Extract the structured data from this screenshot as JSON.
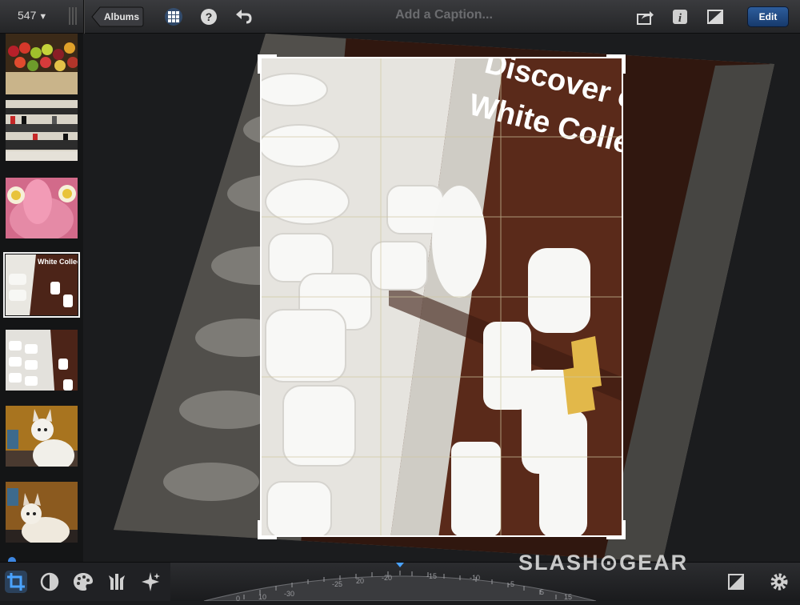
{
  "topbar": {
    "photo_count": "547",
    "albums_label": "Albums",
    "caption_placeholder": "Add a Caption...",
    "edit_label": "Edit"
  },
  "photo": {
    "sign_line1": "Discover our",
    "sign_line2": "White Collection"
  },
  "filmstrip": {
    "thumbnails": [
      {
        "subject": "produce display"
      },
      {
        "subject": "store shelves"
      },
      {
        "subject": "pink face"
      },
      {
        "subject": "white collection",
        "selected": true
      },
      {
        "subject": "white cups"
      },
      {
        "subject": "dog"
      },
      {
        "subject": "dog"
      }
    ]
  },
  "straighten_dial": {
    "tick_labels": [
      "-30",
      "-25",
      "-20",
      "-15",
      "-10",
      "-5",
      "0",
      "5",
      "10",
      "15",
      "20"
    ]
  },
  "watermark": "SLASH⊙GEAR",
  "colors": {
    "edit_accent": "#1f4a85",
    "selected_tool": "#4aa3ff"
  }
}
